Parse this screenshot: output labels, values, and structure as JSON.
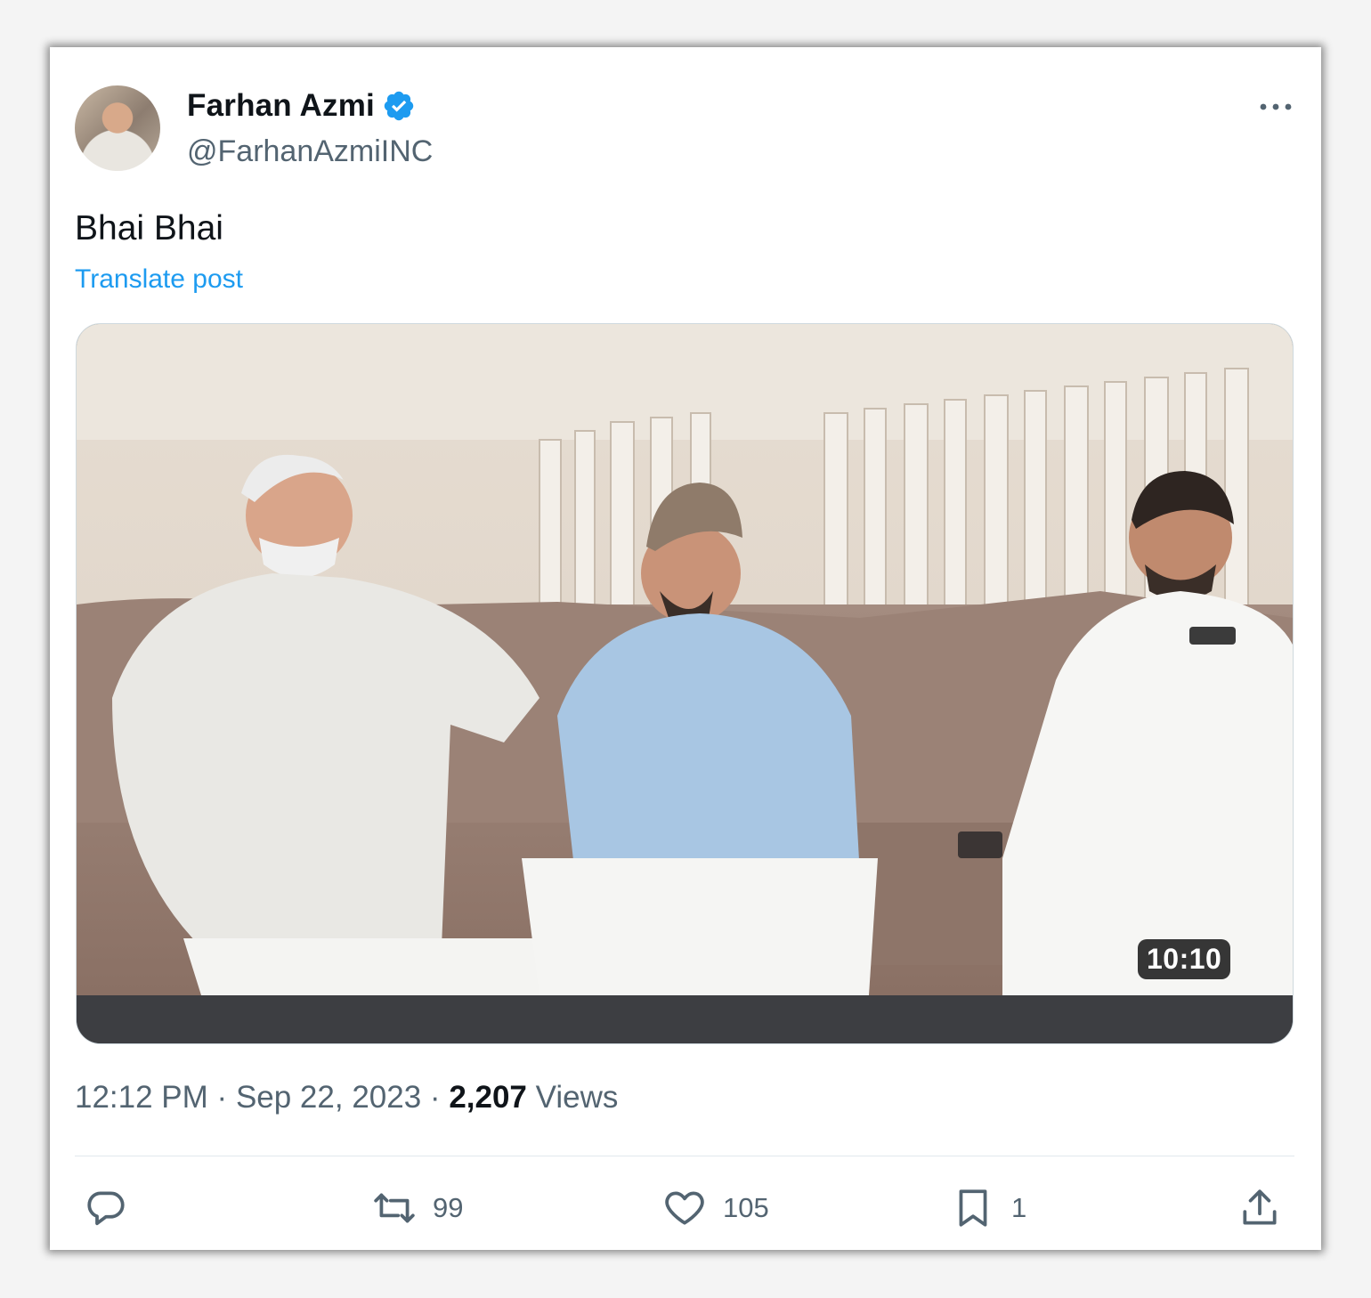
{
  "author": {
    "name": "Farhan Azmi",
    "handle": "@FarhanAzmiINC",
    "verified": true
  },
  "post": {
    "text": "Bhai Bhai",
    "translate_label": "Translate post"
  },
  "media": {
    "type": "video",
    "duration": "10:10"
  },
  "meta": {
    "time": "12:12 PM",
    "separator": "·",
    "date": "Sep 22, 2023",
    "views_count": "2,207",
    "views_label": "Views"
  },
  "actions": {
    "reply_count": "",
    "repost_count": "99",
    "like_count": "105",
    "bookmark_count": "1"
  },
  "colors": {
    "accent": "#1d9bf0",
    "text_primary": "#0f1419",
    "text_secondary": "#536471"
  },
  "icons": [
    "verified-badge-icon",
    "more-icon",
    "reply-icon",
    "repost-icon",
    "like-icon",
    "bookmark-icon",
    "share-icon"
  ]
}
